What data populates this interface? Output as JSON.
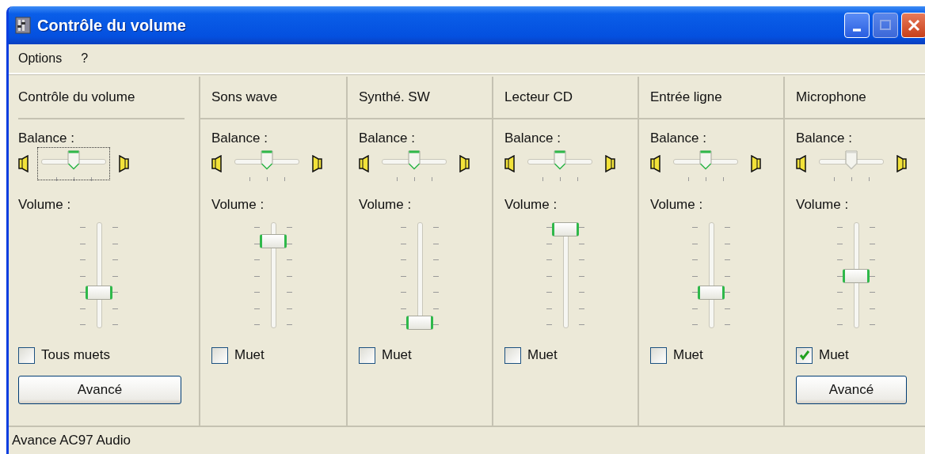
{
  "window": {
    "title": "Contrôle du volume"
  },
  "menu": [
    "Options",
    "?"
  ],
  "channels": [
    {
      "name": "Contrôle du volume",
      "balance_label": "Balance :",
      "balance": {
        "level": 0.5,
        "focused": true,
        "disabled": false
      },
      "volume_label": "Volume :",
      "volume": {
        "level": 0.32
      },
      "mute": {
        "label": "Tous muets",
        "checked": false
      },
      "button": "Avancé"
    },
    {
      "name": "Sons wave",
      "balance_label": "Balance :",
      "balance": {
        "level": 0.5,
        "focused": false,
        "disabled": false
      },
      "volume_label": "Volume :",
      "volume": {
        "level": 0.87
      },
      "mute": {
        "label": "Muet",
        "checked": false
      }
    },
    {
      "name": "Synthé. SW",
      "balance_label": "Balance :",
      "balance": {
        "level": 0.5,
        "focused": false,
        "disabled": false
      },
      "volume_label": "Volume :",
      "volume": {
        "level": 0.0
      },
      "mute": {
        "label": "Muet",
        "checked": false
      }
    },
    {
      "name": "Lecteur CD",
      "balance_label": "Balance :",
      "balance": {
        "level": 0.5,
        "focused": false,
        "disabled": false
      },
      "volume_label": "Volume :",
      "volume": {
        "level": 1.0
      },
      "mute": {
        "label": "Muet",
        "checked": false
      }
    },
    {
      "name": "Entrée ligne",
      "balance_label": "Balance :",
      "balance": {
        "level": 0.5,
        "focused": false,
        "disabled": false
      },
      "volume_label": "Volume :",
      "volume": {
        "level": 0.32
      },
      "mute": {
        "label": "Muet",
        "checked": false
      }
    },
    {
      "name": "Microphone",
      "balance_label": "Balance :",
      "balance": {
        "level": 0.5,
        "focused": false,
        "disabled": true
      },
      "volume_label": "Volume :",
      "volume": {
        "level": 0.5
      },
      "mute": {
        "label": "Muet",
        "checked": true
      },
      "button": "Avancé"
    }
  ],
  "status_bar": "Avance AC97 Audio"
}
